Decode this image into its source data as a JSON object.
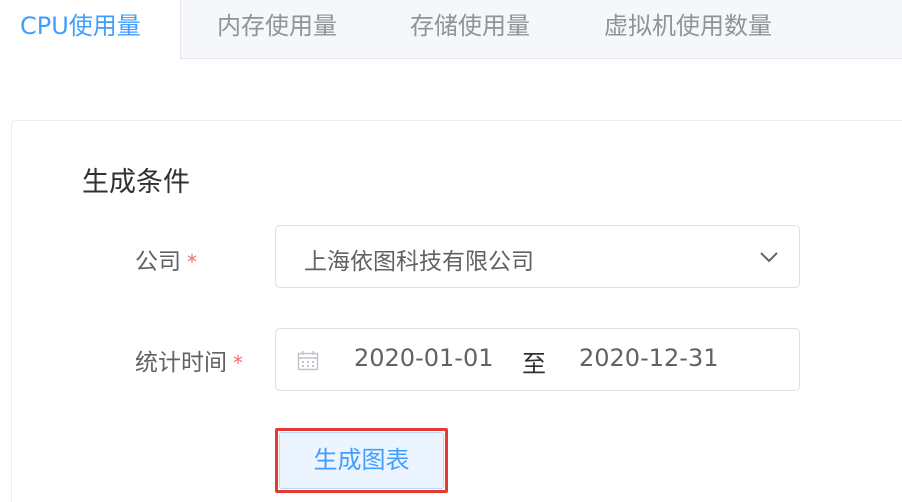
{
  "tabs": [
    {
      "label": "CPU使用量",
      "active": true
    },
    {
      "label": "内存使用量",
      "active": false
    },
    {
      "label": "存储使用量",
      "active": false
    },
    {
      "label": "虚拟机使用数量",
      "active": false
    }
  ],
  "form": {
    "section_title": "生成条件",
    "company": {
      "label": "公司",
      "required_mark": "*",
      "value": "上海依图科技有限公司"
    },
    "date_range": {
      "label": "统计时间",
      "required_mark": "*",
      "start": "2020-01-01",
      "separator": "至",
      "end": "2020-12-31"
    },
    "submit_label": "生成图表"
  },
  "colors": {
    "accent": "#409eff",
    "required": "#f56c6c",
    "highlight_outline": "#e53935"
  },
  "icons": {
    "select_arrow": "chevron-down-icon",
    "date_picker": "calendar-icon"
  }
}
